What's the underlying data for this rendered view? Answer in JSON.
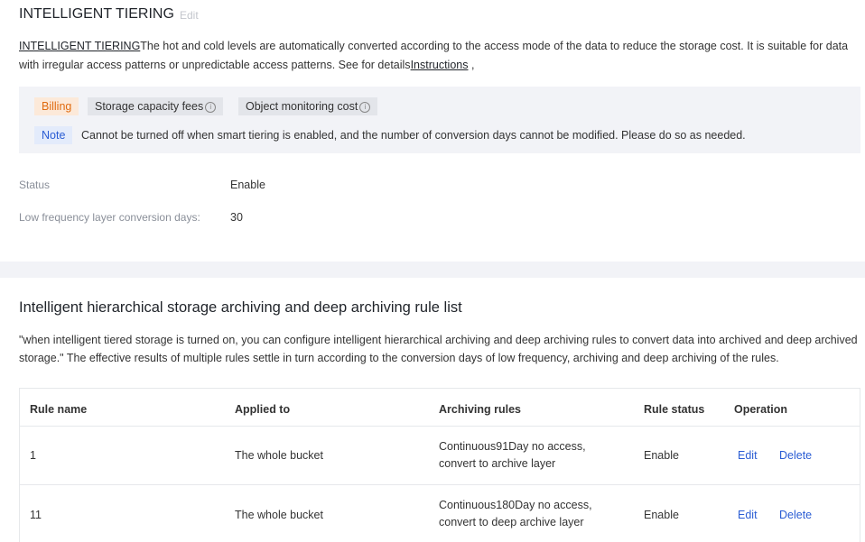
{
  "intelligent_tiering": {
    "title": "INTELLIGENT TIERING",
    "edit_label": "Edit",
    "desc_link": "INTELLIGENT TIERING",
    "desc_text": "The hot and cold levels are automatically converted according to the access mode of the data to reduce the storage cost. It is suitable for data with irregular access patterns or unpredictable access patterns. See for details",
    "instructions_link": "Instructions",
    "desc_end": " ,"
  },
  "notice": {
    "billing_tag": "Billing",
    "fee1": "Storage capacity fees",
    "fee2": "Object monitoring cost",
    "info_glyph": "i",
    "note_tag": "Note",
    "note_text": "Cannot be turned off when smart tiering is enabled, and the number of conversion days cannot be modified. Please do so as needed."
  },
  "status": {
    "status_label": "Status",
    "status_value": "Enable",
    "days_label": "Low frequency layer conversion days:",
    "days_value": "30"
  },
  "rules_section": {
    "title": "Intelligent hierarchical storage archiving and deep archiving rule list",
    "description": "\"when intelligent tiered storage is turned on, you can configure intelligent hierarchical archiving and deep archiving rules to convert data into archived and deep archived storage.\" The effective results of multiple rules settle in turn according to the conversion days of low frequency, archiving and deep archiving of the rules."
  },
  "table": {
    "headers": [
      "Rule name",
      "Applied to",
      "Archiving rules",
      "Rule status",
      "Operation"
    ],
    "rows": [
      {
        "name": "1",
        "applied": "The whole bucket",
        "rule_line1": "Continuous91Day no access,",
        "rule_line2": "convert to archive layer",
        "status": "Enable",
        "edit": "Edit",
        "delete": "Delete"
      },
      {
        "name": "11",
        "applied": "The whole bucket",
        "rule_line1": "Continuous180Day no access,",
        "rule_line2": "convert to deep archive layer",
        "status": "Enable",
        "edit": "Edit",
        "delete": "Delete"
      }
    ]
  },
  "colors": {
    "accent": "#2a5cd4",
    "billing": "#e06b10",
    "panel_bg": "#f2f3f7"
  }
}
